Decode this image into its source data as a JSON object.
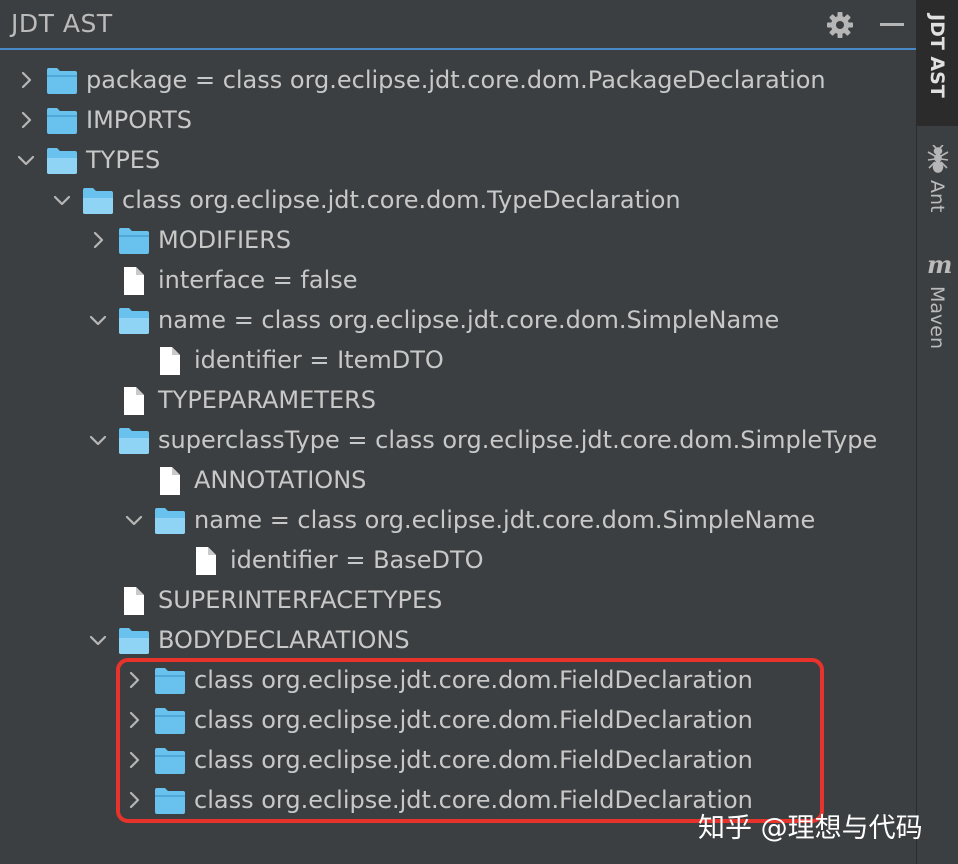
{
  "header": {
    "title": "JDT AST",
    "icons": {
      "settings": "gear-icon",
      "minimize": "minimize-icon"
    }
  },
  "right_strip": {
    "tabs": [
      {
        "label": "JDT AST",
        "active": true
      },
      {
        "label": "Ant",
        "icon": "ant-icon"
      },
      {
        "label": "Maven",
        "icon": "maven-icon",
        "icon_text": "m"
      }
    ]
  },
  "tree": {
    "nodes": [
      {
        "depth": 0,
        "label": "package = class org.eclipse.jdt.core.dom.PackageDeclaration",
        "expander": "collapsed",
        "type": "folder"
      },
      {
        "depth": 0,
        "label": "IMPORTS",
        "expander": "collapsed",
        "type": "folder"
      },
      {
        "depth": 0,
        "label": "TYPES",
        "expander": "expanded",
        "type": "folder-open"
      },
      {
        "depth": 1,
        "label": "class org.eclipse.jdt.core.dom.TypeDeclaration",
        "expander": "expanded",
        "type": "folder-open"
      },
      {
        "depth": 2,
        "label": "MODIFIERS",
        "expander": "collapsed",
        "type": "folder"
      },
      {
        "depth": 2,
        "label": "interface = false",
        "expander": "none",
        "type": "file"
      },
      {
        "depth": 2,
        "label": "name = class org.eclipse.jdt.core.dom.SimpleName",
        "expander": "expanded",
        "type": "folder-open"
      },
      {
        "depth": 3,
        "label": "identifier = ItemDTO",
        "expander": "none",
        "type": "file"
      },
      {
        "depth": 2,
        "label": "TYPEPARAMETERS",
        "expander": "none",
        "type": "file"
      },
      {
        "depth": 2,
        "label": "superclassType = class org.eclipse.jdt.core.dom.SimpleType",
        "expander": "expanded",
        "type": "folder-open"
      },
      {
        "depth": 3,
        "label": "ANNOTATIONS",
        "expander": "none",
        "type": "file"
      },
      {
        "depth": 3,
        "label": "name = class org.eclipse.jdt.core.dom.SimpleName",
        "expander": "expanded",
        "type": "folder-open"
      },
      {
        "depth": 4,
        "label": "identifier = BaseDTO",
        "expander": "none",
        "type": "file"
      },
      {
        "depth": 2,
        "label": "SUPERINTERFACETYPES",
        "expander": "none",
        "type": "file"
      },
      {
        "depth": 2,
        "label": "BODYDECLARATIONS",
        "expander": "expanded",
        "type": "folder-open"
      },
      {
        "depth": 3,
        "label": "class org.eclipse.jdt.core.dom.FieldDeclaration",
        "expander": "collapsed",
        "type": "folder"
      },
      {
        "depth": 3,
        "label": "class org.eclipse.jdt.core.dom.FieldDeclaration",
        "expander": "collapsed",
        "type": "folder"
      },
      {
        "depth": 3,
        "label": "class org.eclipse.jdt.core.dom.FieldDeclaration",
        "expander": "collapsed",
        "type": "folder"
      },
      {
        "depth": 3,
        "label": "class org.eclipse.jdt.core.dom.FieldDeclaration",
        "expander": "collapsed",
        "type": "folder"
      }
    ]
  },
  "watermark": "知乎 @理想与代码",
  "colors": {
    "background": "#3c3f41",
    "text": "#c8c8c8",
    "folder": "#69c2ee",
    "file": "#ffffff",
    "highlight": "#e8332c",
    "header_border": "#4a88c7"
  }
}
